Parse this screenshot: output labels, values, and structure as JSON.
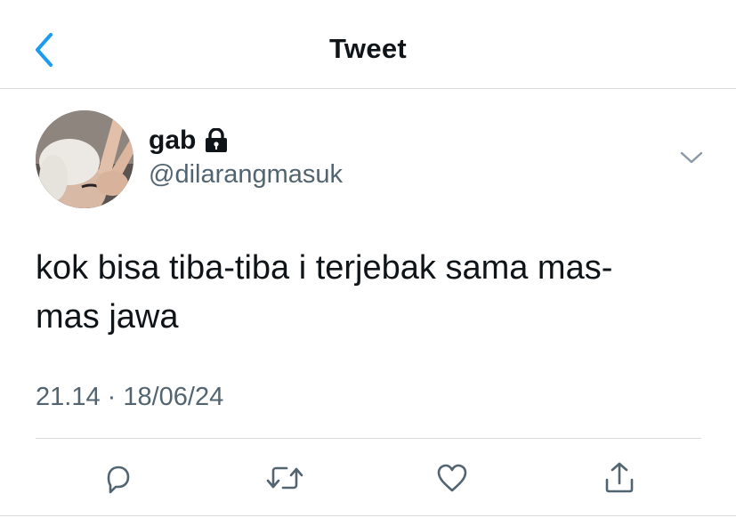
{
  "header": {
    "title": "Tweet",
    "back_icon": "chevron-left-icon",
    "accent_color": "#1d9bf0"
  },
  "author": {
    "name": "gab",
    "handle": "@dilarangmasuk",
    "protected_icon": "lock-icon",
    "avatar_icon": "avatar"
  },
  "tweet": {
    "text_lines": [
      "kok bisa tiba-tiba i terjebak sama mas-",
      "mas jawa"
    ],
    "timestamp": "21.14 · 18/06/24"
  },
  "actions": {
    "more_icon": "chevron-down-icon",
    "reply_icon": "reply-icon",
    "retweet_icon": "retweet-icon",
    "like_icon": "heart-icon",
    "share_icon": "share-icon",
    "icon_color": "#536471"
  }
}
